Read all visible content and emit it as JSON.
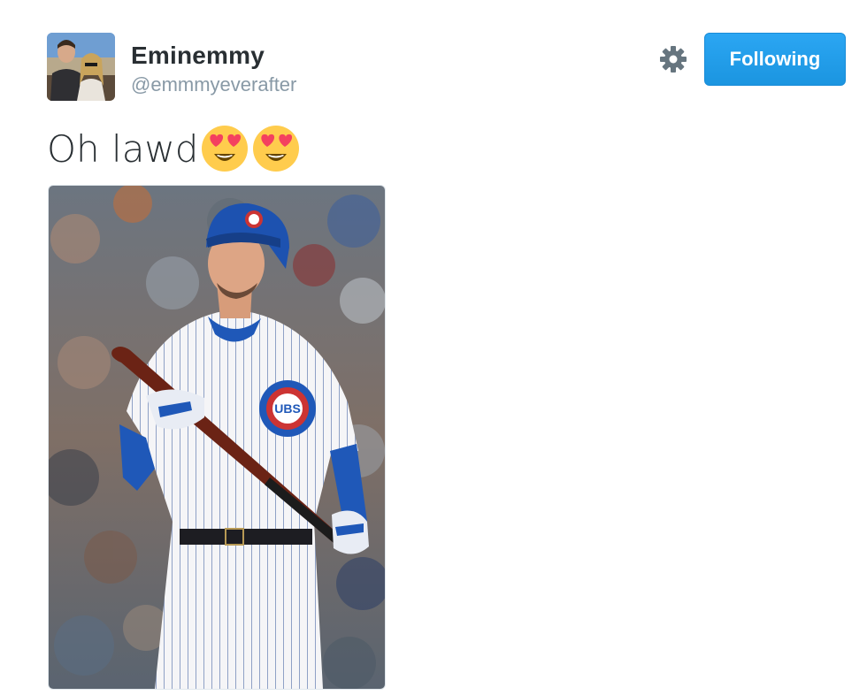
{
  "user": {
    "display_name": "Eminemmy",
    "handle": "@emmmyeverafter",
    "avatar_icon": "profile-photo"
  },
  "actions": {
    "settings_icon": "gear-icon",
    "follow_label": "Following",
    "follow_color": "#1da1f2"
  },
  "tweet": {
    "text": "Oh lawd",
    "emojis": [
      "heart-eyes-emoji",
      "heart-eyes-emoji"
    ]
  },
  "media": {
    "type": "photo",
    "subject": "baseball-player-photo",
    "logo_text": "UBS"
  },
  "colors": {
    "text": "#292f33",
    "secondary": "#8899a6",
    "jersey_blue": "#0e3386",
    "cubs_red": "#cc3433"
  }
}
